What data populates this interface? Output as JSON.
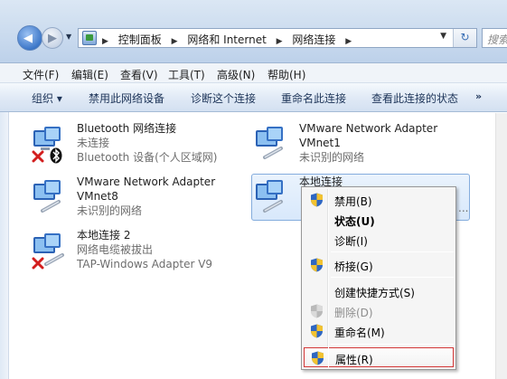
{
  "address": {
    "crumbs": [
      "控制面板",
      "网络和 Internet",
      "网络连接"
    ],
    "search_placeholder": "搜索"
  },
  "menubar": [
    "文件(F)",
    "编辑(E)",
    "查看(V)",
    "工具(T)",
    "高级(N)",
    "帮助(H)"
  ],
  "commands": [
    "组织 ▾",
    "禁用此网络设备",
    "诊断这个连接",
    "重命名此连接",
    "查看此连接的状态",
    "»"
  ],
  "connections": [
    {
      "name": "Bluetooth 网络连接",
      "status": "未连接",
      "device": "Bluetooth 设备(个人区域网)"
    },
    {
      "name": "VMware Network Adapter",
      "name2": "VMnet1",
      "status": "未识别的网络"
    },
    {
      "name": "VMware Network Adapter",
      "name2": "VMnet8",
      "status": "未识别的网络"
    },
    {
      "name": "本地连接",
      "status": "",
      "device": "..."
    },
    {
      "name": "本地连接 2",
      "status": "网络电缆被拔出",
      "device": "TAP-Windows Adapter V9"
    }
  ],
  "context_menu": {
    "items": [
      {
        "label": "禁用(B)",
        "shield": true
      },
      {
        "label": "状态(U)",
        "bold": true
      },
      {
        "label": "诊断(I)"
      },
      {
        "label": "桥接(G)",
        "shield": true
      },
      {
        "label": "创建快捷方式(S)"
      },
      {
        "label": "删除(D)",
        "disabled": true,
        "shield": true
      },
      {
        "label": "重命名(M)",
        "shield": true
      },
      {
        "label": "属性(R)",
        "shield": true,
        "highlighted": true
      }
    ]
  },
  "colors": {
    "highlight_border": "#d33636",
    "selection_bg": "#d8e8fb",
    "error_x": "#d21e1e"
  }
}
